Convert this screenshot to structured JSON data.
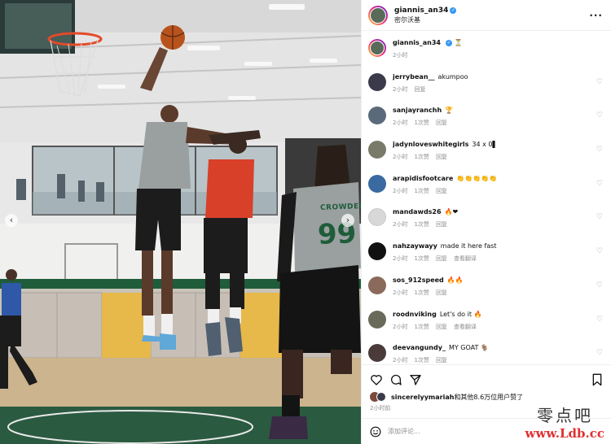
{
  "post": {
    "username": "giannis_an34",
    "location": "密尔沃基"
  },
  "caption": {
    "username": "giannis_an34",
    "emoji": "hourglass-emoji",
    "time": "2小时"
  },
  "labels": {
    "likes": "1次赞",
    "reply": "回复",
    "translate": "查看翻译"
  },
  "comments": [
    {
      "user": "jerrybean__",
      "text": "akumpoo",
      "time": "2小时",
      "show_likes": false,
      "show_translate": false,
      "avatar_color": "#3a3a4a"
    },
    {
      "user": "sanjayranchh",
      "text": "🏆",
      "time": "2小时",
      "show_likes": true,
      "show_translate": false,
      "avatar_color": "#5a6a7a"
    },
    {
      "user": "jadynloveswhitegirls",
      "text": "34 x 0▌",
      "time": "2小时",
      "show_likes": true,
      "show_translate": false,
      "avatar_color": "#7a7a6a"
    },
    {
      "user": "arapidisfootcare",
      "text": "👏👏👏👏👏",
      "time": "2小时",
      "show_likes": true,
      "show_translate": false,
      "avatar_color": "#3a6aa0"
    },
    {
      "user": "mandawds26",
      "text": "🔥❤",
      "time": "2小时",
      "show_likes": true,
      "show_translate": false,
      "avatar_color": "#d8d8d8"
    },
    {
      "user": "nahzaywayy",
      "text": "made it here fast",
      "time": "2小时",
      "show_likes": true,
      "show_translate": true,
      "avatar_color": "#111111"
    },
    {
      "user": "sos_912speed",
      "text": "🔥🔥",
      "time": "2小时",
      "show_likes": true,
      "show_translate": false,
      "avatar_color": "#8a6a5a"
    },
    {
      "user": "roodnviking",
      "text": "Let's do it 🔥",
      "time": "2小时",
      "show_likes": true,
      "show_translate": true,
      "avatar_color": "#6a6a5a"
    },
    {
      "user": "deevangundy_",
      "text": "MY GOAT 🐐",
      "time": "2小时",
      "show_likes": true,
      "show_translate": false,
      "avatar_color": "#4a3a3a"
    }
  ],
  "liked_by": {
    "user": "sincerelyymariah",
    "rest": "和其他8.6万位用户赞了"
  },
  "time_ago": "2小时前",
  "add_comment_placeholder": "添加评论...",
  "watermark": {
    "line1": "零点吧",
    "line2": "www.Ldb.cc"
  },
  "photo": {
    "jersey_name": "CROWDER",
    "jersey_number": "99"
  },
  "colors": {
    "verified": "#3897f0",
    "court_green": "#1f5c3a",
    "jersey_gray": "#9aa0a0",
    "jersey_red": "#d8402a",
    "muted_text": "#8e8e8e"
  }
}
